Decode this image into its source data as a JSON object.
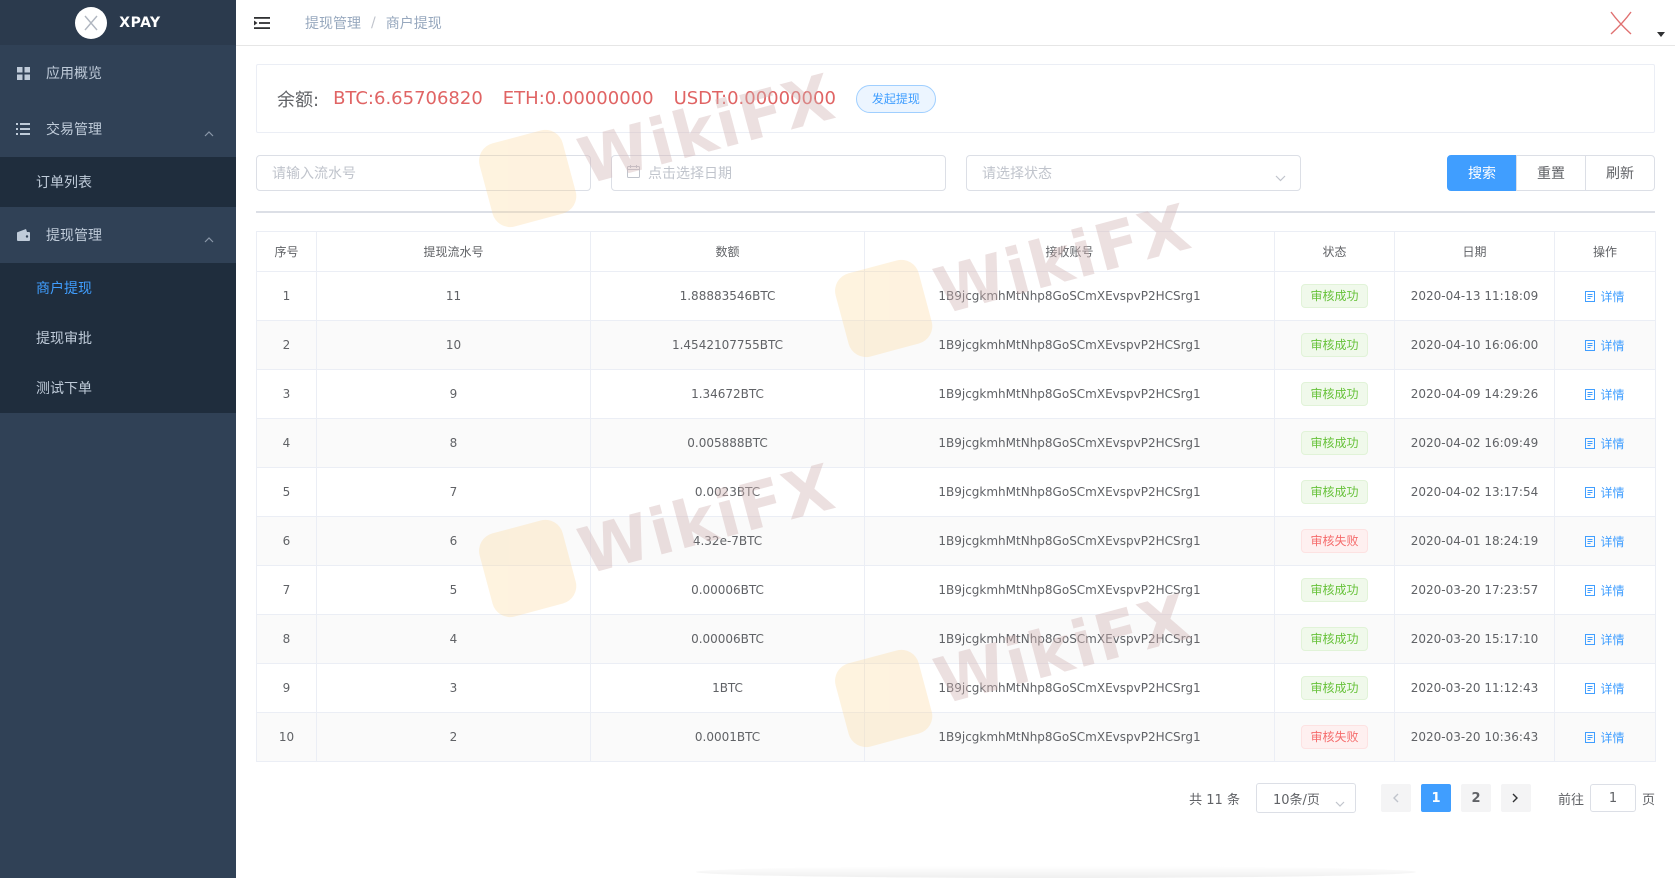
{
  "app": {
    "logo_text": "XPAY"
  },
  "sidebar": {
    "items": [
      {
        "label": "应用概览",
        "icon": "dashboard-icon"
      },
      {
        "label": "交易管理",
        "icon": "list-icon",
        "children": [
          {
            "label": "订单列表"
          }
        ]
      },
      {
        "label": "提现管理",
        "icon": "wallet-icon",
        "children": [
          {
            "label": "商户提现",
            "active": true
          },
          {
            "label": "提现审批"
          },
          {
            "label": "测试下单"
          }
        ]
      }
    ]
  },
  "header": {
    "breadcrumb": [
      "提现管理",
      "商户提现"
    ],
    "breadcrumb_separator": "/"
  },
  "balance": {
    "label": "余额:",
    "btc": "BTC:6.65706820",
    "eth": "ETH:0.00000000",
    "usdt": "USDT:0.00000000",
    "withdraw_button": "发起提现"
  },
  "filters": {
    "serial_placeholder": "请输入流水号",
    "date_placeholder": "点击选择日期",
    "status_placeholder": "请选择状态",
    "search_button": "搜索",
    "reset_button": "重置",
    "refresh_button": "刷新"
  },
  "table": {
    "columns": [
      "序号",
      "提现流水号",
      "数额",
      "接收账号",
      "状态",
      "日期",
      "操作"
    ],
    "rows": [
      {
        "index": "1",
        "serial": "11",
        "amount": "1.88883546BTC",
        "account": "1B9jcgkmhMtNhp8GoSCmXEvspvP2HCSrg1",
        "status": "审核成功",
        "status_type": "ok",
        "date": "2020-04-13 11:18:09",
        "action": "详情"
      },
      {
        "index": "2",
        "serial": "10",
        "amount": "1.4542107755BTC",
        "account": "1B9jcgkmhMtNhp8GoSCmXEvspvP2HCSrg1",
        "status": "审核成功",
        "status_type": "ok",
        "date": "2020-04-10 16:06:00",
        "action": "详情"
      },
      {
        "index": "3",
        "serial": "9",
        "amount": "1.34672BTC",
        "account": "1B9jcgkmhMtNhp8GoSCmXEvspvP2HCSrg1",
        "status": "审核成功",
        "status_type": "ok",
        "date": "2020-04-09 14:29:26",
        "action": "详情"
      },
      {
        "index": "4",
        "serial": "8",
        "amount": "0.005888BTC",
        "account": "1B9jcgkmhMtNhp8GoSCmXEvspvP2HCSrg1",
        "status": "审核成功",
        "status_type": "ok",
        "date": "2020-04-02 16:09:49",
        "action": "详情"
      },
      {
        "index": "5",
        "serial": "7",
        "amount": "0.0023BTC",
        "account": "1B9jcgkmhMtNhp8GoSCmXEvspvP2HCSrg1",
        "status": "审核成功",
        "status_type": "ok",
        "date": "2020-04-02 13:17:54",
        "action": "详情"
      },
      {
        "index": "6",
        "serial": "6",
        "amount": "4.32e-7BTC",
        "account": "1B9jcgkmhMtNhp8GoSCmXEvspvP2HCSrg1",
        "status": "审核失败",
        "status_type": "fail",
        "date": "2020-04-01 18:24:19",
        "action": "详情"
      },
      {
        "index": "7",
        "serial": "5",
        "amount": "0.00006BTC",
        "account": "1B9jcgkmhMtNhp8GoSCmXEvspvP2HCSrg1",
        "status": "审核成功",
        "status_type": "ok",
        "date": "2020-03-20 17:23:57",
        "action": "详情"
      },
      {
        "index": "8",
        "serial": "4",
        "amount": "0.00006BTC",
        "account": "1B9jcgkmhMtNhp8GoSCmXEvspvP2HCSrg1",
        "status": "审核成功",
        "status_type": "ok",
        "date": "2020-03-20 15:17:10",
        "action": "详情"
      },
      {
        "index": "9",
        "serial": "3",
        "amount": "1BTC",
        "account": "1B9jcgkmhMtNhp8GoSCmXEvspvP2HCSrg1",
        "status": "审核成功",
        "status_type": "ok",
        "date": "2020-03-20 11:12:43",
        "action": "详情"
      },
      {
        "index": "10",
        "serial": "2",
        "amount": "0.0001BTC",
        "account": "1B9jcgkmhMtNhp8GoSCmXEvspvP2HCSrg1",
        "status": "审核失败",
        "status_type": "fail",
        "date": "2020-03-20 10:36:43",
        "action": "详情"
      }
    ]
  },
  "pagination": {
    "total": "共 11 条",
    "page_size": "10条/页",
    "pages": [
      "1",
      "2"
    ],
    "current_page": "1",
    "goto_label": "前往",
    "goto_value": "1",
    "goto_suffix": "页"
  },
  "watermark": {
    "text": "WikiFX"
  },
  "colors": {
    "sidebar_bg": "#304156",
    "submenu_bg": "#1f2d3d",
    "primary": "#409eff",
    "balance_red": "#e06464",
    "success": "#67c23a",
    "danger": "#f56c6c"
  }
}
